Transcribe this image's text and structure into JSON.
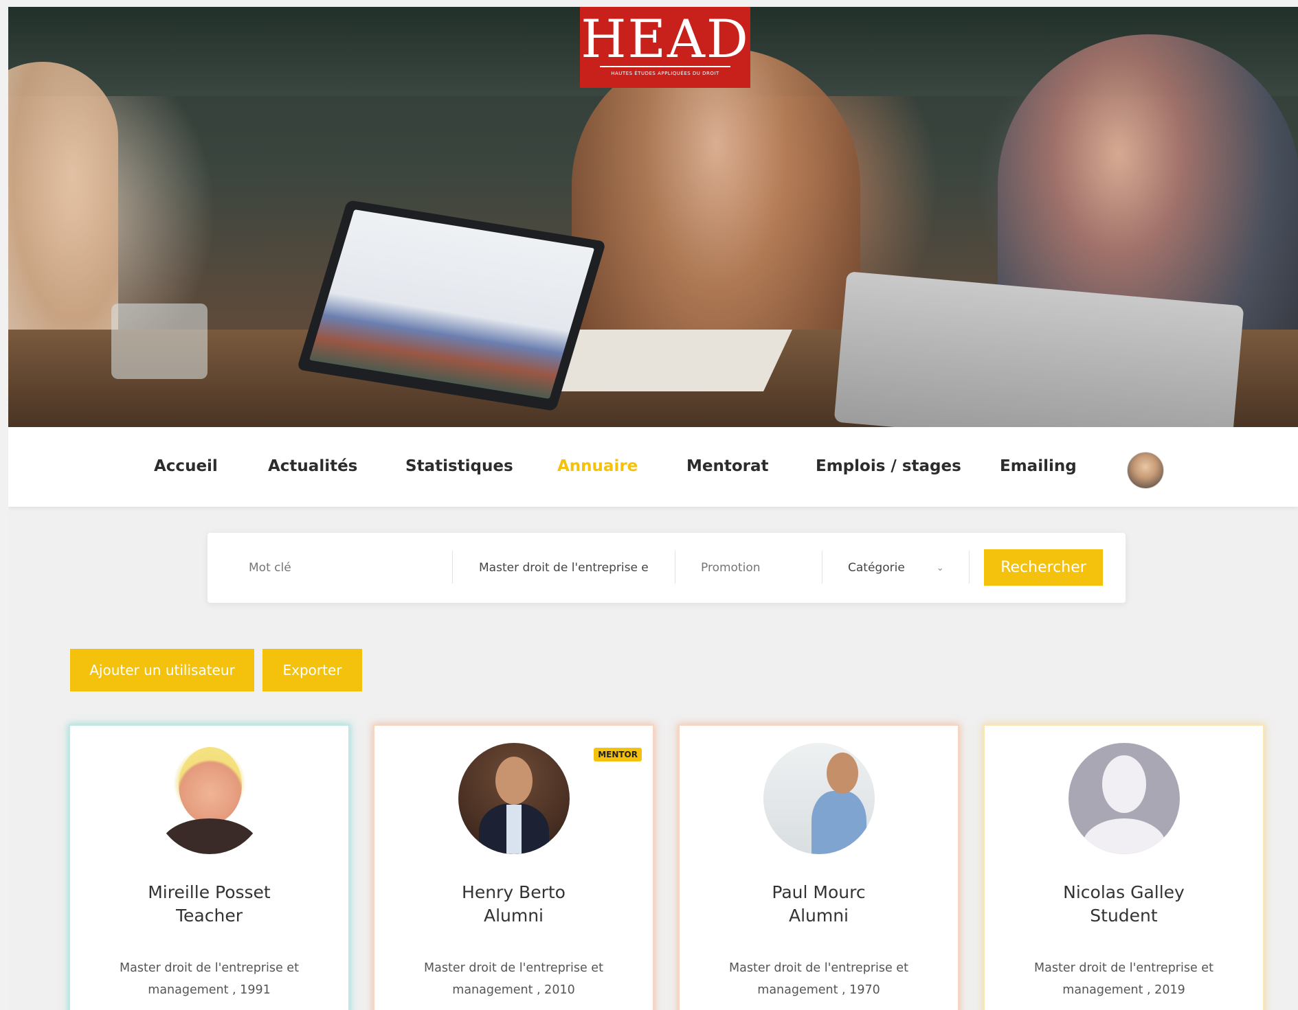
{
  "brand": {
    "logo_word": "HEAD",
    "logo_subtitle": "HAUTES ÉTUDES APPLIQUÉES DU DROIT",
    "logo_color": "#c8201b",
    "accent_color": "#f4c20d"
  },
  "nav": {
    "items": [
      {
        "label": "Accueil"
      },
      {
        "label": "Actualités"
      },
      {
        "label": "Statistiques"
      },
      {
        "label": "Annuaire",
        "active": true
      },
      {
        "label": "Mentorat"
      },
      {
        "label": "Emplois / stages"
      },
      {
        "label": "Emailing"
      }
    ],
    "avatar_icon": "user-avatar"
  },
  "search": {
    "keyword_placeholder": "Mot clé",
    "program_value": "Master droit de l'entreprise e",
    "promotion_placeholder": "Promotion",
    "category_placeholder": "Catégorie",
    "submit_label": "Rechercher"
  },
  "actions": {
    "add_user_label": "Ajouter un utilisateur",
    "export_label": "Exporter"
  },
  "cards": [
    {
      "name": "Mireille Posset",
      "role": "Teacher",
      "program": "Master droit de l'entreprise et management , 1991",
      "accent": "teal",
      "badge": ""
    },
    {
      "name": "Henry Berto",
      "role": "Alumni",
      "program": "Master droit de l'entreprise et management , 2010",
      "accent": "orange",
      "badge": "MENTOR"
    },
    {
      "name": "Paul Mourc",
      "role": "Alumni",
      "program": "Master droit de l'entreprise et management , 1970",
      "accent": "orange",
      "badge": ""
    },
    {
      "name": "Nicolas Galley",
      "role": "Student",
      "program": "Master droit de l'entreprise et management , 2019",
      "accent": "yellow",
      "badge": ""
    }
  ]
}
